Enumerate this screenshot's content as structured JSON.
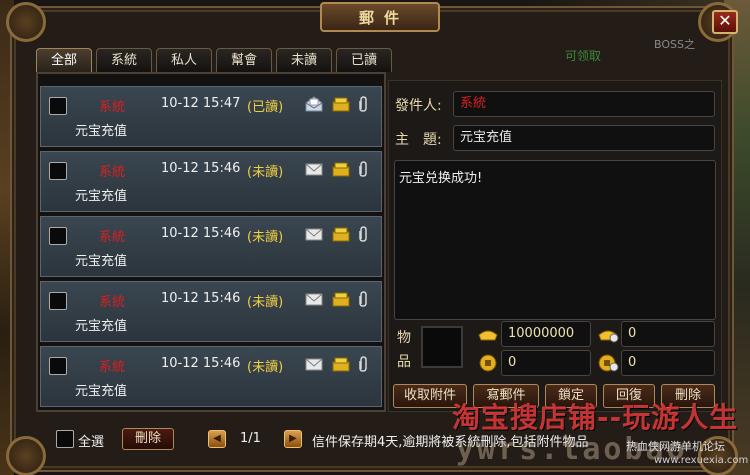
{
  "window": {
    "title": "郵件",
    "close_label": "✕"
  },
  "background": {
    "faint_text": "可领取",
    "boss_text": "BOSS之"
  },
  "tabs": [
    {
      "label": "全部",
      "active": true
    },
    {
      "label": "系統",
      "active": false
    },
    {
      "label": "私人",
      "active": false
    },
    {
      "label": "幫會",
      "active": false
    },
    {
      "label": "未讀",
      "active": false
    },
    {
      "label": "已讀",
      "active": false
    }
  ],
  "mails": [
    {
      "sender": "系統",
      "date": "10-12 15:47",
      "status": "(已讀)",
      "subject": "元宝充值",
      "icons": [
        "open-envelope-icon",
        "coin-icon",
        "paperclip-icon"
      ]
    },
    {
      "sender": "系統",
      "date": "10-12 15:46",
      "status": "(未讀)",
      "subject": "元宝充值",
      "icons": [
        "envelope-icon",
        "coin-icon",
        "paperclip-icon"
      ]
    },
    {
      "sender": "系統",
      "date": "10-12 15:46",
      "status": "(未讀)",
      "subject": "元宝充值",
      "icons": [
        "envelope-icon",
        "coin-icon",
        "paperclip-icon"
      ]
    },
    {
      "sender": "系統",
      "date": "10-12 15:46",
      "status": "(未讀)",
      "subject": "元宝充值",
      "icons": [
        "envelope-icon",
        "coin-icon",
        "paperclip-icon"
      ]
    },
    {
      "sender": "系統",
      "date": "10-12 15:46",
      "status": "(未讀)",
      "subject": "元宝充值",
      "icons": [
        "envelope-icon",
        "coin-icon",
        "paperclip-icon"
      ]
    }
  ],
  "detail": {
    "sender_label": "發件人:",
    "sender_value": "系統",
    "subject_label": "主　題:",
    "subject_value": "元宝充值",
    "body": "元宝兑换成功!",
    "items_label_1": "物",
    "items_label_2": "品",
    "gold_ingot": "10000000",
    "bound_ingot": "0",
    "gold_coin": "0",
    "bound_coin": "0"
  },
  "actions": {
    "collect": "收取附件",
    "send": "寫郵件",
    "lock": "鎖定",
    "reply": "回復",
    "delete": "刪除"
  },
  "footer": {
    "select_all": "全選",
    "delete": "刪除",
    "prev": "◀",
    "next": "▶",
    "page": "1/1",
    "notice": "信件保存期4天,逾期將被系統刪除,包括附件物品"
  },
  "watermark": {
    "shop": "淘宝搜店铺--玩游人生",
    "url_stamp": "ywrs.taobao",
    "forum": "热血侠网游单机论坛",
    "forum_url": "www.rexuexia.com"
  },
  "colors": {
    "sender_red": "#d82020",
    "status_yellow": "#f0d040",
    "row_bg": "#3a4650",
    "frame_gold": "#b08a50"
  }
}
